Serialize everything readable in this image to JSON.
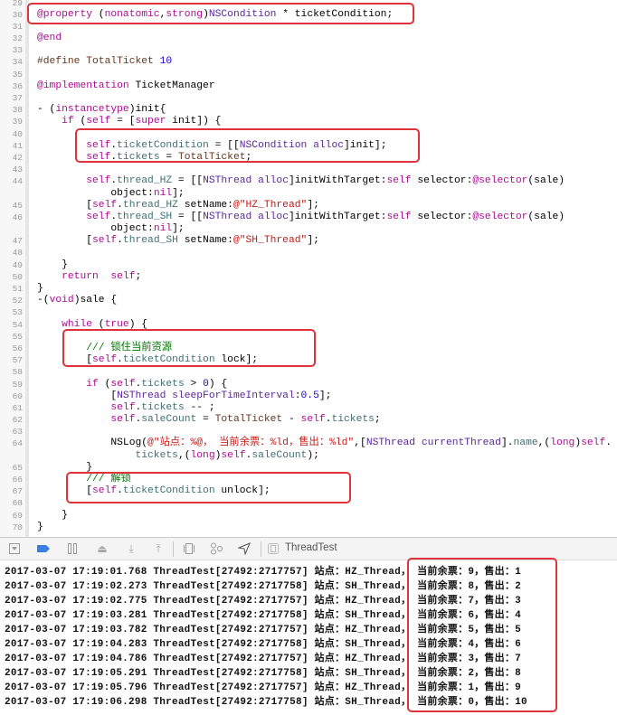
{
  "editor": {
    "lines": [
      {
        "n": "29",
        "t": []
      },
      {
        "n": "30",
        "t": [
          [
            "k",
            "@property"
          ],
          [
            "p",
            " ("
          ],
          [
            "k",
            "nonatomic"
          ],
          [
            "p",
            ","
          ],
          [
            "k",
            "strong"
          ],
          [
            "p",
            ")"
          ],
          [
            "c",
            "NSCondition"
          ],
          [
            "p",
            " * ticketCondition;"
          ]
        ]
      },
      {
        "n": "31",
        "t": []
      },
      {
        "n": "32",
        "t": [
          [
            "k",
            "@end"
          ]
        ]
      },
      {
        "n": "33",
        "t": []
      },
      {
        "n": "34",
        "t": [
          [
            "d",
            "#define TotalTicket "
          ],
          [
            "n",
            "10"
          ]
        ]
      },
      {
        "n": "35",
        "t": []
      },
      {
        "n": "36",
        "t": [
          [
            "k",
            "@implementation"
          ],
          [
            "p",
            " TicketManager"
          ]
        ]
      },
      {
        "n": "37",
        "t": []
      },
      {
        "n": "38",
        "t": [
          [
            "p",
            "- ("
          ],
          [
            "k",
            "instancetype"
          ],
          [
            "p",
            ")init{"
          ]
        ]
      },
      {
        "n": "39",
        "t": [
          [
            "p",
            "    "
          ],
          [
            "k",
            "if"
          ],
          [
            "p",
            " ("
          ],
          [
            "k",
            "self"
          ],
          [
            "p",
            " = ["
          ],
          [
            "k",
            "super"
          ],
          [
            "p",
            " init]) {"
          ]
        ]
      },
      {
        "n": "40",
        "t": []
      },
      {
        "n": "41",
        "t": [
          [
            "p",
            "        "
          ],
          [
            "k",
            "self"
          ],
          [
            "p",
            "."
          ],
          [
            "m",
            "ticketCondition"
          ],
          [
            "p",
            " = [["
          ],
          [
            "c",
            "NSCondition"
          ],
          [
            "p",
            " "
          ],
          [
            "c",
            "alloc"
          ],
          [
            "p",
            "]init];"
          ]
        ]
      },
      {
        "n": "42",
        "t": [
          [
            "p",
            "        "
          ],
          [
            "k",
            "self"
          ],
          [
            "p",
            "."
          ],
          [
            "m",
            "tickets"
          ],
          [
            "p",
            " = "
          ],
          [
            "d",
            "TotalTicket"
          ],
          [
            "p",
            ";"
          ]
        ]
      },
      {
        "n": "43",
        "t": []
      },
      {
        "n": "44",
        "t": [
          [
            "p",
            "        "
          ],
          [
            "k",
            "self"
          ],
          [
            "p",
            "."
          ],
          [
            "m",
            "thread_HZ"
          ],
          [
            "p",
            " = [["
          ],
          [
            "c",
            "NSThread"
          ],
          [
            "p",
            " "
          ],
          [
            "c",
            "alloc"
          ],
          [
            "p",
            "]initWithTarget:"
          ],
          [
            "k",
            "self"
          ],
          [
            "p",
            " selector:"
          ],
          [
            "k",
            "@selector"
          ],
          [
            "p",
            "(sale)"
          ]
        ]
      },
      {
        "n": "",
        "t": [
          [
            "p",
            "            object:"
          ],
          [
            "k",
            "nil"
          ],
          [
            "p",
            "];"
          ]
        ]
      },
      {
        "n": "45",
        "t": [
          [
            "p",
            "        ["
          ],
          [
            "k",
            "self"
          ],
          [
            "p",
            "."
          ],
          [
            "m",
            "thread_HZ"
          ],
          [
            "p",
            " setName:"
          ],
          [
            "s",
            "@\"HZ_Thread\""
          ],
          [
            "p",
            "];"
          ]
        ]
      },
      {
        "n": "46",
        "t": [
          [
            "p",
            "        "
          ],
          [
            "k",
            "self"
          ],
          [
            "p",
            "."
          ],
          [
            "m",
            "thread_SH"
          ],
          [
            "p",
            " = [["
          ],
          [
            "c",
            "NSThread"
          ],
          [
            "p",
            " "
          ],
          [
            "c",
            "alloc"
          ],
          [
            "p",
            "]initWithTarget:"
          ],
          [
            "k",
            "self"
          ],
          [
            "p",
            " selector:"
          ],
          [
            "k",
            "@selector"
          ],
          [
            "p",
            "(sale)"
          ]
        ]
      },
      {
        "n": "",
        "t": [
          [
            "p",
            "            object:"
          ],
          [
            "k",
            "nil"
          ],
          [
            "p",
            "];"
          ]
        ]
      },
      {
        "n": "47",
        "t": [
          [
            "p",
            "        ["
          ],
          [
            "k",
            "self"
          ],
          [
            "p",
            "."
          ],
          [
            "m",
            "thread_SH"
          ],
          [
            "p",
            " setName:"
          ],
          [
            "s",
            "@\"SH_Thread\""
          ],
          [
            "p",
            "];"
          ]
        ]
      },
      {
        "n": "48",
        "t": []
      },
      {
        "n": "49",
        "t": [
          [
            "p",
            "    }"
          ]
        ]
      },
      {
        "n": "50",
        "t": [
          [
            "p",
            "    "
          ],
          [
            "k",
            "return"
          ],
          [
            "p",
            "  "
          ],
          [
            "k",
            "self"
          ],
          [
            "p",
            ";"
          ]
        ]
      },
      {
        "n": "51",
        "t": [
          [
            "p",
            "}"
          ]
        ]
      },
      {
        "n": "52",
        "t": [
          [
            "p",
            "-("
          ],
          [
            "k",
            "void"
          ],
          [
            "p",
            ")sale {"
          ]
        ]
      },
      {
        "n": "53",
        "t": []
      },
      {
        "n": "54",
        "t": [
          [
            "p",
            "    "
          ],
          [
            "k",
            "while"
          ],
          [
            "p",
            " ("
          ],
          [
            "k",
            "true"
          ],
          [
            "p",
            ") {"
          ]
        ]
      },
      {
        "n": "55",
        "t": []
      },
      {
        "n": "56",
        "t": [
          [
            "p",
            "        "
          ],
          [
            "t",
            "/// 锁住当前资源"
          ]
        ]
      },
      {
        "n": "57",
        "t": [
          [
            "p",
            "        ["
          ],
          [
            "k",
            "self"
          ],
          [
            "p",
            "."
          ],
          [
            "m",
            "ticketCondition"
          ],
          [
            "p",
            " lock];"
          ]
        ]
      },
      {
        "n": "58",
        "t": []
      },
      {
        "n": "59",
        "t": [
          [
            "p",
            "        "
          ],
          [
            "k",
            "if"
          ],
          [
            "p",
            " ("
          ],
          [
            "k",
            "self"
          ],
          [
            "p",
            "."
          ],
          [
            "m",
            "tickets"
          ],
          [
            "p",
            " > "
          ],
          [
            "n",
            "0"
          ],
          [
            "p",
            ") {"
          ]
        ]
      },
      {
        "n": "60",
        "t": [
          [
            "p",
            "            ["
          ],
          [
            "c",
            "NSThread"
          ],
          [
            "p",
            " "
          ],
          [
            "c",
            "sleepForTimeInterval"
          ],
          [
            "p",
            ":"
          ],
          [
            "n",
            "0.5"
          ],
          [
            "p",
            "];"
          ]
        ]
      },
      {
        "n": "61",
        "t": [
          [
            "p",
            "            "
          ],
          [
            "k",
            "self"
          ],
          [
            "p",
            "."
          ],
          [
            "m",
            "tickets"
          ],
          [
            "p",
            " -- ;"
          ]
        ]
      },
      {
        "n": "62",
        "t": [
          [
            "p",
            "            "
          ],
          [
            "k",
            "self"
          ],
          [
            "p",
            "."
          ],
          [
            "m",
            "saleCount"
          ],
          [
            "p",
            " = "
          ],
          [
            "d",
            "TotalTicket"
          ],
          [
            "p",
            " - "
          ],
          [
            "k",
            "self"
          ],
          [
            "p",
            "."
          ],
          [
            "m",
            "tickets"
          ],
          [
            "p",
            ";"
          ]
        ]
      },
      {
        "n": "63",
        "t": []
      },
      {
        "n": "64",
        "t": [
          [
            "p",
            "            NSLog("
          ],
          [
            "s",
            "@\"站点：%@， 当前余票：%ld，售出：%ld\""
          ],
          [
            "p",
            ",["
          ],
          [
            "c",
            "NSThread"
          ],
          [
            "p",
            " "
          ],
          [
            "c",
            "currentThread"
          ],
          [
            "p",
            "]."
          ],
          [
            "m",
            "name"
          ],
          [
            "p",
            ",("
          ],
          [
            "k",
            "long"
          ],
          [
            "p",
            ")"
          ],
          [
            "k",
            "self"
          ],
          [
            "p",
            "."
          ]
        ]
      },
      {
        "n": "",
        "t": [
          [
            "p",
            "                "
          ],
          [
            "m",
            "tickets"
          ],
          [
            "p",
            ",("
          ],
          [
            "k",
            "long"
          ],
          [
            "p",
            ")"
          ],
          [
            "k",
            "self"
          ],
          [
            "p",
            "."
          ],
          [
            "m",
            "saleCount"
          ],
          [
            "p",
            ");"
          ]
        ]
      },
      {
        "n": "65",
        "t": [
          [
            "p",
            "        }"
          ]
        ]
      },
      {
        "n": "66",
        "t": [
          [
            "p",
            "        "
          ],
          [
            "t",
            "/// 解锁"
          ]
        ]
      },
      {
        "n": "67",
        "t": [
          [
            "p",
            "        ["
          ],
          [
            "k",
            "self"
          ],
          [
            "p",
            "."
          ],
          [
            "m",
            "ticketCondition"
          ],
          [
            "p",
            " unlock];"
          ]
        ]
      },
      {
        "n": "68",
        "t": []
      },
      {
        "n": "69",
        "t": [
          [
            "p",
            "    }"
          ]
        ]
      },
      {
        "n": "70",
        "t": [
          [
            "p",
            "}"
          ]
        ]
      }
    ]
  },
  "toolbar": {
    "target_label": "ThreadTest",
    "icons": [
      "hide-debug-area-icon",
      "breakpoints-toggle-icon",
      "pause-icon",
      "step-over-icon",
      "step-into-icon",
      "step-out-icon",
      "view-hierarchy-icon",
      "memory-graph-icon",
      "location-icon",
      "target-app-icon"
    ]
  },
  "console": {
    "lines": [
      {
        "prefix": "2017-03-07 17:19:01.768 ThreadTest[27492:2717757] 站点：HZ_Thread， ",
        "result": "当前余票：9，售出：1"
      },
      {
        "prefix": "2017-03-07 17:19:02.273 ThreadTest[27492:2717758] 站点：SH_Thread， ",
        "result": "当前余票：8，售出：2"
      },
      {
        "prefix": "2017-03-07 17:19:02.775 ThreadTest[27492:2717757] 站点：HZ_Thread， ",
        "result": "当前余票：7，售出：3"
      },
      {
        "prefix": "2017-03-07 17:19:03.281 ThreadTest[27492:2717758] 站点：SH_Thread， ",
        "result": "当前余票：6，售出：4"
      },
      {
        "prefix": "2017-03-07 17:19:03.782 ThreadTest[27492:2717757] 站点：HZ_Thread， ",
        "result": "当前余票：5，售出：5"
      },
      {
        "prefix": "2017-03-07 17:19:04.283 ThreadTest[27492:2717758] 站点：SH_Thread， ",
        "result": "当前余票：4，售出：6"
      },
      {
        "prefix": "2017-03-07 17:19:04.786 ThreadTest[27492:2717757] 站点：HZ_Thread， ",
        "result": "当前余票：3，售出：7"
      },
      {
        "prefix": "2017-03-07 17:19:05.291 ThreadTest[27492:2717758] 站点：SH_Thread， ",
        "result": "当前余票：2，售出：8"
      },
      {
        "prefix": "2017-03-07 17:19:05.796 ThreadTest[27492:2717757] 站点：HZ_Thread， ",
        "result": "当前余票：1，售出：9"
      },
      {
        "prefix": "2017-03-07 17:19:06.298 ThreadTest[27492:2717758] 站点：SH_Thread， ",
        "result": "当前余票：0，售出：10"
      }
    ]
  },
  "colors": {
    "highlight_box": "#e0323a",
    "keyword": "#aa0d91",
    "class": "#5c2699",
    "string": "#c41a16",
    "comment": "#007400",
    "number": "#1c00cf"
  }
}
